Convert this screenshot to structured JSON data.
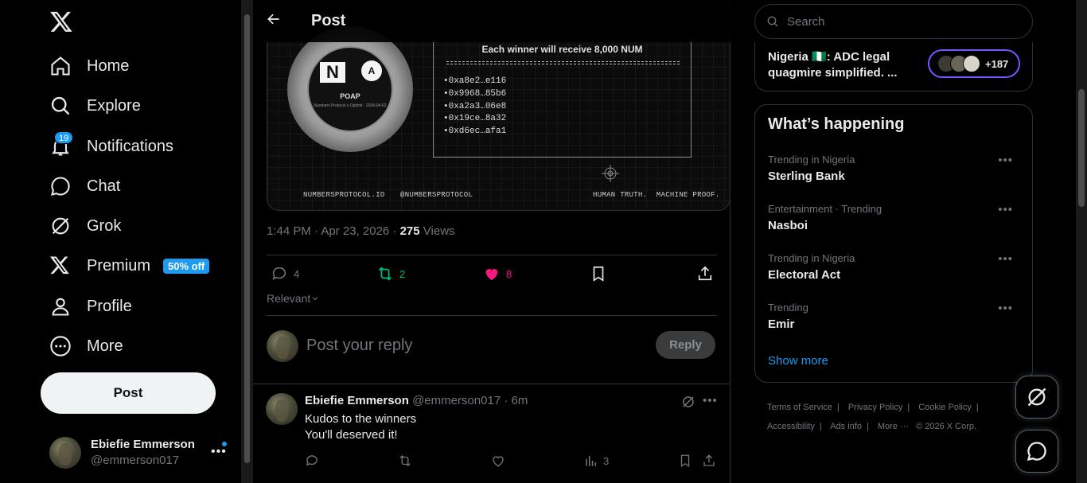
{
  "nav": {
    "items": [
      {
        "label": "Home",
        "icon": "home-icon"
      },
      {
        "label": "Explore",
        "icon": "search-icon"
      },
      {
        "label": "Notifications",
        "icon": "bell-icon",
        "badge": "19"
      },
      {
        "label": "Chat",
        "icon": "chat-icon"
      },
      {
        "label": "Grok",
        "icon": "grok-icon"
      },
      {
        "label": "Premium",
        "icon": "x-icon",
        "promo": "50% off"
      },
      {
        "label": "Profile",
        "icon": "person-icon"
      },
      {
        "label": "More",
        "icon": "more-circle-icon"
      }
    ],
    "post_label": "Post",
    "account": {
      "name": "Ebiefie Emmerson",
      "handle": "@emmerson017"
    }
  },
  "main": {
    "title": "Post",
    "media": {
      "poap_label": "POAP",
      "poap_sub": "Numbers Protocol x Optimit · 2026-04-02",
      "winners_title": "Each winner will receive 8,000 NUM",
      "winners": [
        "0xa8e2…e116",
        "0x9968…85b6",
        "0xa2a3…06e8",
        "0x19ce…8a32",
        "0xd6ec…afa1"
      ],
      "footer_left1": "NUMBERSPROTOCOL.IO",
      "footer_left2": "@NUMBERSPROTOCOL",
      "footer_right": "HUMAN TRUTH.  MACHINE PROOF."
    },
    "meta": {
      "time": "1:44 PM · Apr 23, 2026 · ",
      "views_count": "275",
      "views_label": " Views"
    },
    "actions": {
      "replies": "4",
      "reposts": "2",
      "likes": "8"
    },
    "sort_label": "Relevant",
    "reply_placeholder": "Post your reply",
    "reply_button": "Reply",
    "reply": {
      "name": "Ebiefie Emmerson",
      "handle_time": "@emmerson017 · 6m",
      "line1": "Kudos to the winners",
      "line2": "You'll deserved it!",
      "views": "3"
    }
  },
  "right": {
    "search_placeholder": "Search",
    "space": {
      "title": "Nigeria 🇳🇬: ADC legal quagmire simplified. ...",
      "count": "+187"
    },
    "trends_title": "What’s happening",
    "trends": [
      {
        "context": "Trending in Nigeria",
        "name": "Sterling Bank"
      },
      {
        "context": "Entertainment · Trending",
        "name": "Nasboi"
      },
      {
        "context": "Trending in Nigeria",
        "name": "Electoral Act"
      },
      {
        "context": "Trending",
        "name": "Emir"
      }
    ],
    "show_more": "Show more",
    "footer": {
      "terms": "Terms of Service",
      "privacy": "Privacy Policy",
      "cookie": "Cookie Policy",
      "accessibility": "Accessibility",
      "ads": "Ads info",
      "more": "More ···",
      "copyright": "© 2026 X Corp."
    }
  },
  "colors": {
    "accent": "#1d9bf0",
    "repost": "#00ba7c",
    "like": "#f91880",
    "space_ring": "#7856ff"
  }
}
